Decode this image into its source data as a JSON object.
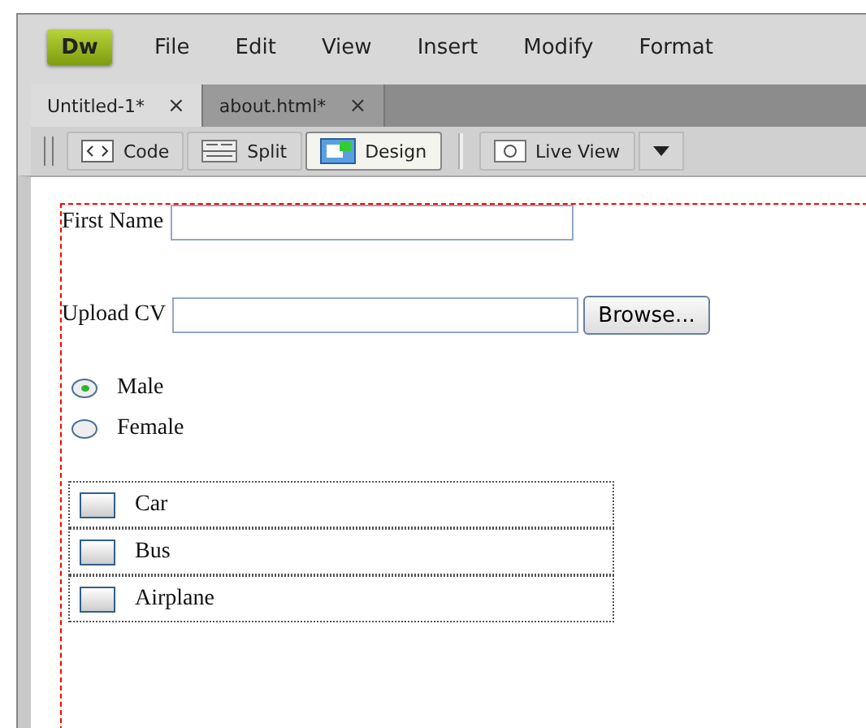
{
  "app": {
    "logo": "Dw"
  },
  "menu": [
    "File",
    "Edit",
    "View",
    "Insert",
    "Modify",
    "Format"
  ],
  "tabs": [
    {
      "label": "Untitled-1*",
      "close": "×",
      "selected": true
    },
    {
      "label": "about.html*",
      "close": "×",
      "selected": false
    }
  ],
  "view_buttons": [
    {
      "label": "Code",
      "kind": "code",
      "selected": false
    },
    {
      "label": "Split",
      "kind": "split",
      "selected": false
    },
    {
      "label": "Design",
      "kind": "design",
      "selected": true
    }
  ],
  "live_view": {
    "label": "Live View"
  },
  "form": {
    "first_name": {
      "label": "First Name"
    },
    "upload": {
      "label": "Upload CV",
      "button": "Browse..."
    },
    "radios": [
      {
        "label": "Male",
        "selected": true
      },
      {
        "label": "Female",
        "selected": false
      }
    ],
    "checkboxes": [
      {
        "label": "Car",
        "checked": false
      },
      {
        "label": "Bus",
        "checked": false
      },
      {
        "label": "Airplane",
        "checked": false
      }
    ]
  }
}
